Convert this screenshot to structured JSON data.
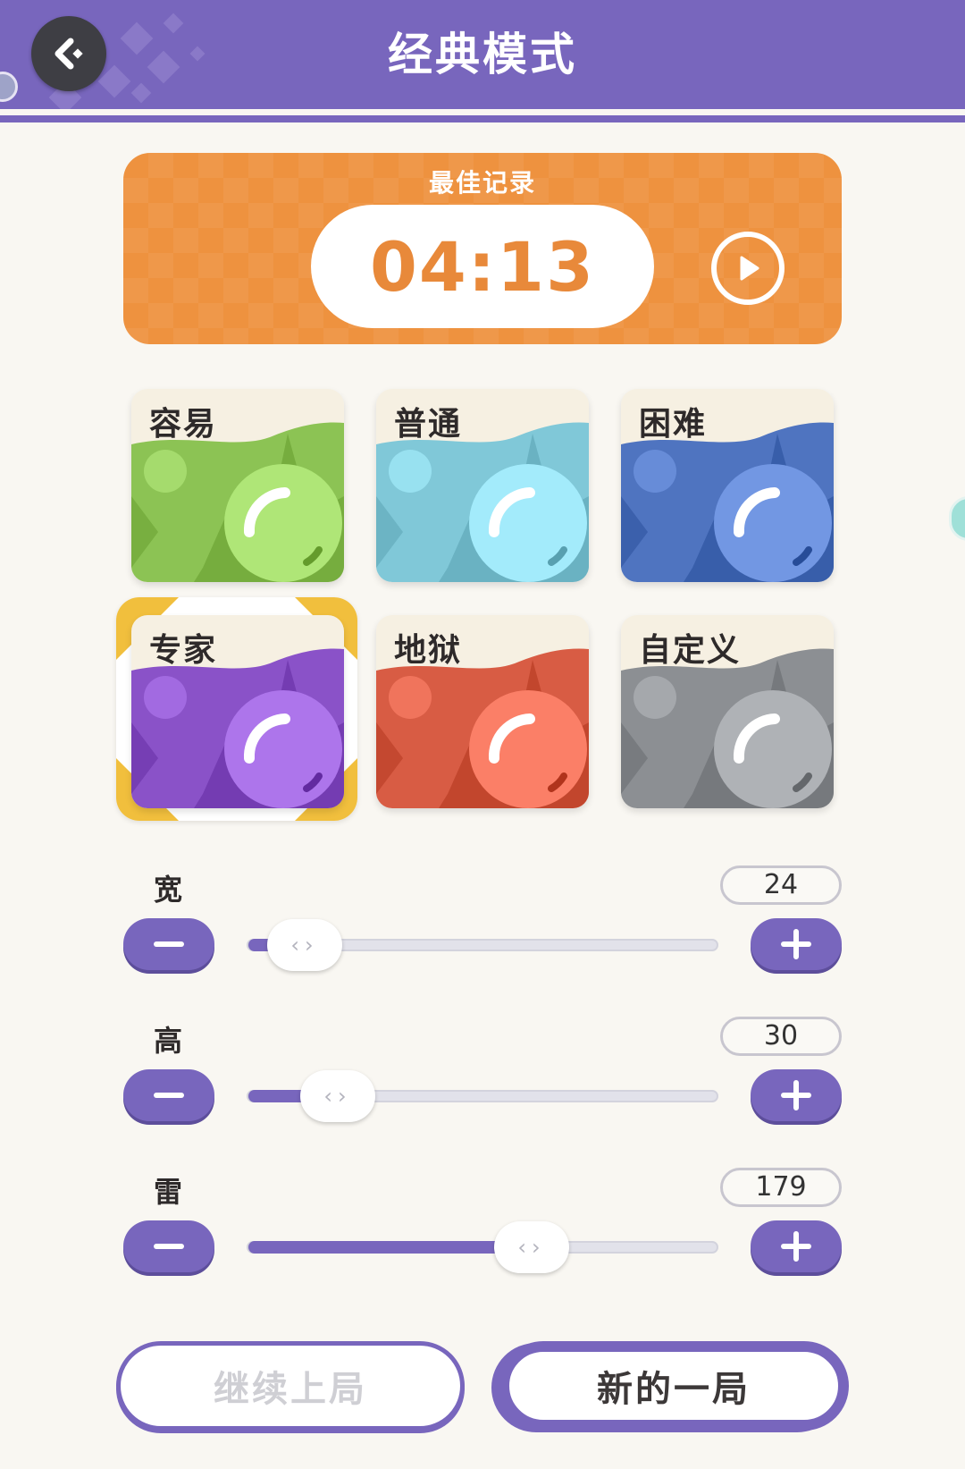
{
  "header": {
    "title": "经典模式"
  },
  "record": {
    "label": "最佳记录",
    "time": "04:13"
  },
  "difficulties": [
    {
      "label": "容易",
      "color": "#8cc354"
    },
    {
      "label": "普通",
      "color": "#80c8d8"
    },
    {
      "label": "困难",
      "color": "#4f74c0"
    },
    {
      "label": "专家",
      "color": "#8a52c8",
      "selected": true
    },
    {
      "label": "地狱",
      "color": "#d85c44"
    },
    {
      "label": "自定义",
      "color": "#8c8f93"
    }
  ],
  "sliders": [
    {
      "label": "宽",
      "value": "24",
      "fill": 0.12
    },
    {
      "label": "高",
      "value": "30",
      "fill": 0.19
    },
    {
      "label": "雷",
      "value": "179",
      "fill": 0.6
    }
  ],
  "buttons": {
    "continue": "继续上局",
    "new_game": "新的一局"
  },
  "colors": {
    "accent": "#7866bd",
    "record": "#ee923f",
    "highlight": "#f1bf3d"
  }
}
